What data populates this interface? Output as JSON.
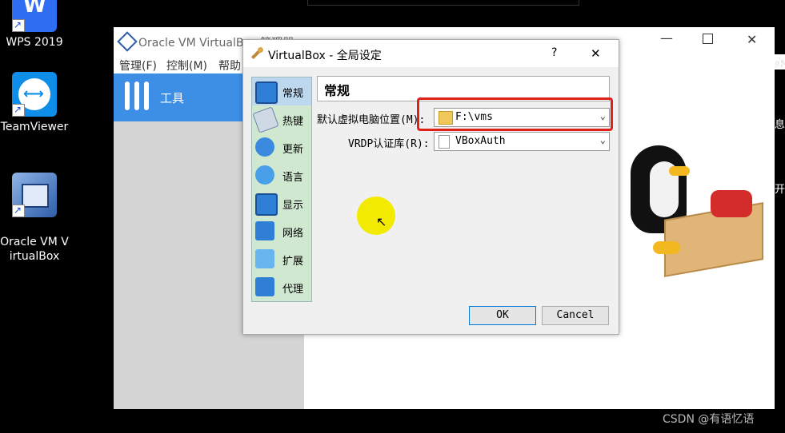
{
  "desktop": {
    "icons": [
      {
        "label": "WPS 2019"
      },
      {
        "label": "TeamViewer"
      },
      {
        "label": "Oracle VM V\nirtualBox"
      }
    ]
  },
  "main_window": {
    "title": "Oracle VM VirtualBox 管理器",
    "menu": [
      "管理(F)",
      "控制(M)",
      "帮助"
    ],
    "tools_label": "工具",
    "right_fragments": [
      "办",
      "息",
      "开"
    ]
  },
  "dialog": {
    "title": "VirtualBox - 全局设定",
    "help": "?",
    "close": "✕",
    "categories": [
      {
        "label": "常规",
        "icon": "monitor-icon"
      },
      {
        "label": "热键",
        "icon": "keyboard-icon"
      },
      {
        "label": "更新",
        "icon": "update-icon"
      },
      {
        "label": "语言",
        "icon": "globe-icon"
      },
      {
        "label": "显示",
        "icon": "display-icon"
      },
      {
        "label": "网络",
        "icon": "network-icon"
      },
      {
        "label": "扩展",
        "icon": "extension-icon"
      },
      {
        "label": "代理",
        "icon": "proxy-icon"
      }
    ],
    "section_title": "常规",
    "fields": {
      "vm_folder_label": "默认虚拟电脑位置(M):",
      "vm_folder_value": "F:\\vms",
      "vrdp_label": "VRDP认证库(R):",
      "vrdp_value": "VBoxAuth"
    },
    "ok": "OK",
    "cancel": "Cancel"
  },
  "watermark": "CSDN @有语忆语",
  "colors": {
    "accent": "#3d8fe6",
    "highlight_box": "#e0201b",
    "cursor_spot": "#f2ea00",
    "category_bg": "#cfe8cf"
  }
}
